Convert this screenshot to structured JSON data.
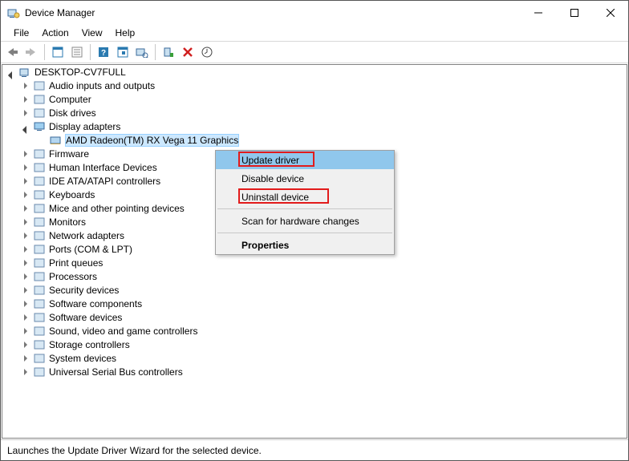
{
  "title": "Device Manager",
  "menubar": [
    "File",
    "Action",
    "View",
    "Help"
  ],
  "root": "DESKTOP-CV7FULL",
  "categories": [
    {
      "label": "Audio inputs and outputs",
      "exp": false
    },
    {
      "label": "Computer",
      "exp": false
    },
    {
      "label": "Disk drives",
      "exp": false
    },
    {
      "label": "Display adapters",
      "exp": true,
      "children": [
        {
          "label": "AMD Radeon(TM) RX Vega 11 Graphics",
          "sel": true
        }
      ]
    },
    {
      "label": "Firmware",
      "exp": false
    },
    {
      "label": "Human Interface Devices",
      "exp": false
    },
    {
      "label": "IDE ATA/ATAPI controllers",
      "exp": false
    },
    {
      "label": "Keyboards",
      "exp": false
    },
    {
      "label": "Mice and other pointing devices",
      "exp": false
    },
    {
      "label": "Monitors",
      "exp": false
    },
    {
      "label": "Network adapters",
      "exp": false
    },
    {
      "label": "Ports (COM & LPT)",
      "exp": false
    },
    {
      "label": "Print queues",
      "exp": false
    },
    {
      "label": "Processors",
      "exp": false
    },
    {
      "label": "Security devices",
      "exp": false
    },
    {
      "label": "Software components",
      "exp": false
    },
    {
      "label": "Software devices",
      "exp": false
    },
    {
      "label": "Sound, video and game controllers",
      "exp": false
    },
    {
      "label": "Storage controllers",
      "exp": false
    },
    {
      "label": "System devices",
      "exp": false
    },
    {
      "label": "Universal Serial Bus controllers",
      "exp": false
    }
  ],
  "context_menu": {
    "items": [
      {
        "label": "Update driver",
        "hl": true,
        "redbox": true
      },
      {
        "label": "Disable device"
      },
      {
        "label": "Uninstall device",
        "redbox": true
      },
      {
        "sep": true
      },
      {
        "label": "Scan for hardware changes"
      },
      {
        "sep": true
      },
      {
        "label": "Properties",
        "bold": true
      }
    ]
  },
  "statusbar": "Launches the Update Driver Wizard for the selected device."
}
